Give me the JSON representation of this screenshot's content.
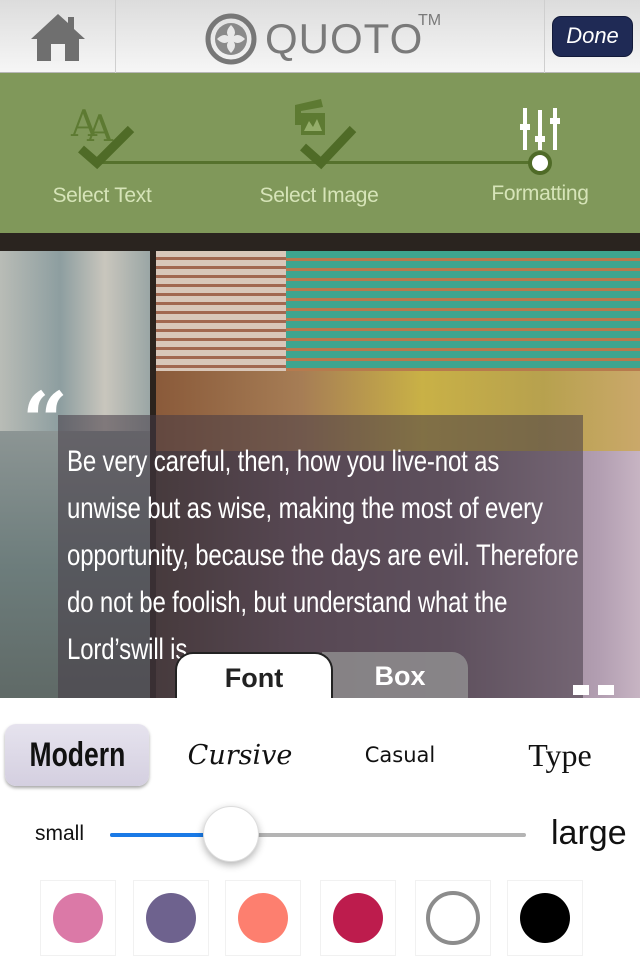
{
  "navbar": {
    "home_icon": "home-icon",
    "brand_name": "QUOTO",
    "brand_tm": "TM",
    "done_label": "Done"
  },
  "steps": [
    {
      "label": "Select Text",
      "icon": "text-check-icon",
      "state": "complete"
    },
    {
      "label": "Select Image",
      "icon": "image-check-icon",
      "state": "complete"
    },
    {
      "label": "Formatting",
      "icon": "sliders-icon",
      "state": "current"
    }
  ],
  "preview": {
    "quote_mark": "“",
    "text": "Be very careful, then, how you live-not as unwise but as wise, making the most of every opportunity, because the days are evil. Therefore do not be foolish, but understand what the Lord’swill is."
  },
  "tabs": [
    {
      "label": "Font",
      "selected": true
    },
    {
      "label": "Box",
      "selected": false
    }
  ],
  "fonts": [
    {
      "label": "Modern",
      "selected": true
    },
    {
      "label": "Cursive",
      "selected": false
    },
    {
      "label": "Casual",
      "selected": false
    },
    {
      "label": "Type",
      "selected": false
    }
  ],
  "size": {
    "min_label": "small",
    "max_label": "large",
    "value_fraction": 0.29
  },
  "colors": {
    "accent": "#1a7ae6",
    "step_bg": "#80985a",
    "done_bg": "#1f2a55",
    "swatches": [
      {
        "name": "pink",
        "hex": "#db79a7"
      },
      {
        "name": "purple",
        "hex": "#6e628e"
      },
      {
        "name": "salmon",
        "hex": "#fd7f6f"
      },
      {
        "name": "crimson",
        "hex": "#bd1c4d"
      },
      {
        "name": "white",
        "hex": "#ffffff"
      },
      {
        "name": "black",
        "hex": "#000000"
      }
    ]
  }
}
